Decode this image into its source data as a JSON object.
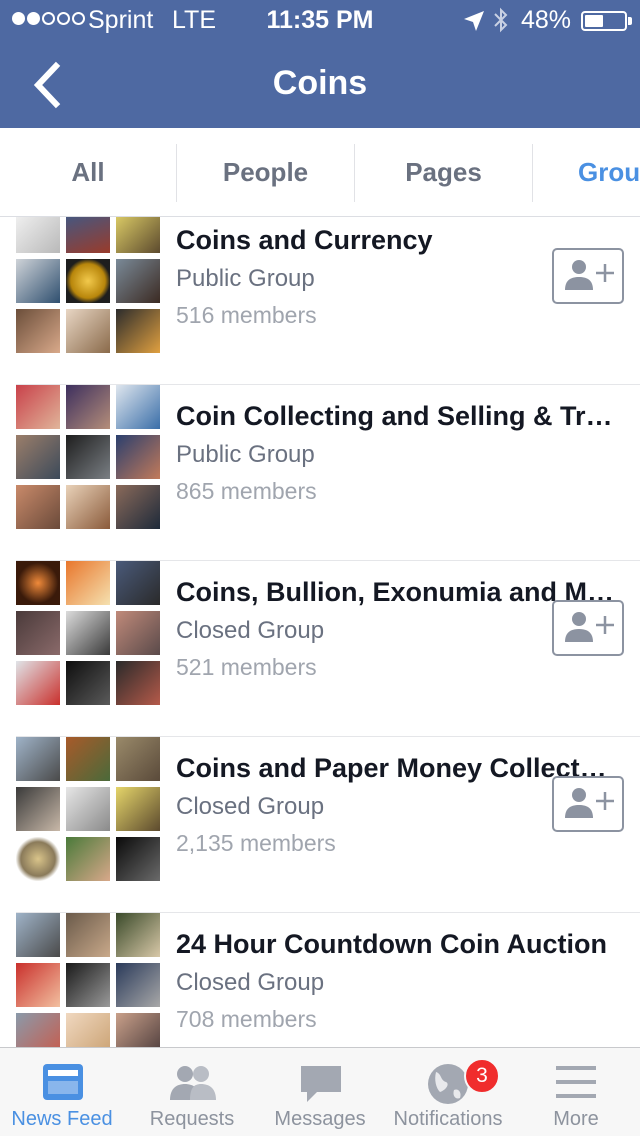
{
  "status_bar": {
    "carrier": "Sprint",
    "network": "LTE",
    "time": "11:35 PM",
    "battery_percent": "48%",
    "battery_level": 0.48,
    "signal_bars_filled": 2,
    "signal_bars_total": 5
  },
  "nav": {
    "title": "Coins",
    "back_icon": "chevron-left-icon"
  },
  "tabs": [
    {
      "label": "All",
      "active": false
    },
    {
      "label": "People",
      "active": false
    },
    {
      "label": "Pages",
      "active": false
    },
    {
      "label": "Groups",
      "active": true
    }
  ],
  "results": [
    {
      "name": "Coins and Currency",
      "type": "Public Group",
      "members": "516 members",
      "join_button": true
    },
    {
      "name": "Coin Collecting and Selling & Trading",
      "type": "Public Group",
      "members": "865 members",
      "join_button": false
    },
    {
      "name": "Coins, Bullion, Exonumia and More",
      "type": "Closed Group",
      "members": "521 members",
      "join_button": true
    },
    {
      "name": "Coins and Paper Money Collectors",
      "type": "Closed Group",
      "members": "2,135 members",
      "join_button": true
    },
    {
      "name": "24 Hour Countdown Coin Auction",
      "type": "Closed Group",
      "members": "708 members",
      "join_button": false
    }
  ],
  "tab_bar": [
    {
      "label": "News Feed",
      "icon": "news-feed-icon",
      "active": true
    },
    {
      "label": "Requests",
      "icon": "friend-requests-icon",
      "active": false
    },
    {
      "label": "Messages",
      "icon": "messages-icon",
      "active": false
    },
    {
      "label": "Notifications",
      "icon": "globe-icon",
      "active": false,
      "badge": "3"
    },
    {
      "label": "More",
      "icon": "hamburger-menu-icon",
      "active": false
    }
  ],
  "colors": {
    "header": "#4e69a2",
    "accent": "#4a90e2",
    "badge": "#f02d2d",
    "text_primary": "#141823",
    "text_secondary": "#6a7180",
    "text_tertiary": "#a0a5ae"
  }
}
